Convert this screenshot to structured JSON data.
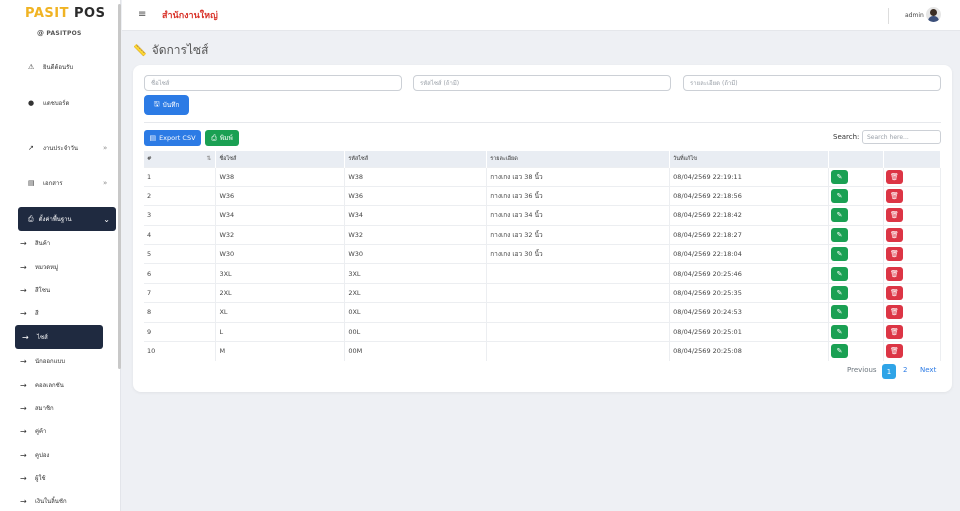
{
  "brand": {
    "name_part1": "PASIT",
    "name_part2": "POS",
    "subtitle": "PASITPOS"
  },
  "sidebar": {
    "items": [
      {
        "label": "ยินดีต้อนรับ",
        "icon": "warning-icon"
      },
      {
        "label": "แดชบอร์ด",
        "icon": "info-icon"
      },
      {
        "label": "งานประจำวัน",
        "icon": "trend-icon"
      },
      {
        "label": "เอกสาร",
        "icon": "document-icon"
      }
    ],
    "active_group": {
      "label": "ตั้งค่าพื้นฐาน",
      "icon": "printer-icon"
    },
    "sub_items": [
      {
        "label": "สินค้า"
      },
      {
        "label": "หมวดหมู่"
      },
      {
        "label": "สีโซน"
      },
      {
        "label": "สี"
      },
      {
        "label": "ไซส์"
      },
      {
        "label": "นักออกแบบ"
      },
      {
        "label": "คอลเลกชัน"
      },
      {
        "label": "สมาชิก"
      },
      {
        "label": "คู่ค้า"
      },
      {
        "label": "คูปอง"
      },
      {
        "label": "ผู้ใช้"
      },
      {
        "label": "เงินในลิ้นชัก"
      }
    ],
    "active_sub_index": 4
  },
  "topbar": {
    "branch": "สำนักงานใหญ่",
    "user": "admin"
  },
  "page": {
    "title": "จัดการไซส์"
  },
  "form": {
    "name_placeholder": "ชื่อไซส์",
    "code_placeholder": "รหัสไซส์ (ถ้ามี)",
    "detail_placeholder": "รายละเอียด (ถ้ามี)",
    "save_label": "บันทึก"
  },
  "toolbar": {
    "export_label": "Export CSV",
    "print_label": "พิมพ์",
    "search_label": "Search:",
    "search_placeholder": "Search here..."
  },
  "table": {
    "headers": [
      "#",
      "ชื่อไซส์",
      "รหัสไซส์",
      "รายละเอียด",
      "วันที่แก้ไข",
      "",
      ""
    ],
    "rows": [
      {
        "no": "1",
        "name": "W38",
        "code": "W38",
        "detail": "กางเกง เอว 38 นิ้ว",
        "date": "08/04/2569 22:19:11"
      },
      {
        "no": "2",
        "name": "W36",
        "code": "W36",
        "detail": "กางเกง เอว 36 นิ้ว",
        "date": "08/04/2569 22:18:56"
      },
      {
        "no": "3",
        "name": "W34",
        "code": "W34",
        "detail": "กางเกง เอว 34 นิ้ว",
        "date": "08/04/2569 22:18:42"
      },
      {
        "no": "4",
        "name": "W32",
        "code": "W32",
        "detail": "กางเกง เอว 32 นิ้ว",
        "date": "08/04/2569 22:18:27"
      },
      {
        "no": "5",
        "name": "W30",
        "code": "W30",
        "detail": "กางเกง เอว 30 นิ้ว",
        "date": "08/04/2569 22:18:04"
      },
      {
        "no": "6",
        "name": "3XL",
        "code": "3XL",
        "detail": "",
        "date": "08/04/2569 20:25:46"
      },
      {
        "no": "7",
        "name": "2XL",
        "code": "2XL",
        "detail": "",
        "date": "08/04/2569 20:25:35"
      },
      {
        "no": "8",
        "name": "XL",
        "code": "0XL",
        "detail": "",
        "date": "08/04/2569 20:24:53"
      },
      {
        "no": "9",
        "name": "L",
        "code": "00L",
        "detail": "",
        "date": "08/04/2569 20:25:01"
      },
      {
        "no": "10",
        "name": "M",
        "code": "00M",
        "detail": "",
        "date": "08/04/2569 20:25:08"
      }
    ]
  },
  "pagination": {
    "previous": "Previous",
    "pages": [
      "1",
      "2"
    ],
    "current": "1",
    "next": "Next"
  },
  "colors": {
    "primary": "#2c7be5",
    "success": "#1aa053",
    "danger": "#dc3545",
    "sidebar_active": "#1f2a40",
    "brand_accent": "#f0b323",
    "branch_text": "#d9342b"
  }
}
